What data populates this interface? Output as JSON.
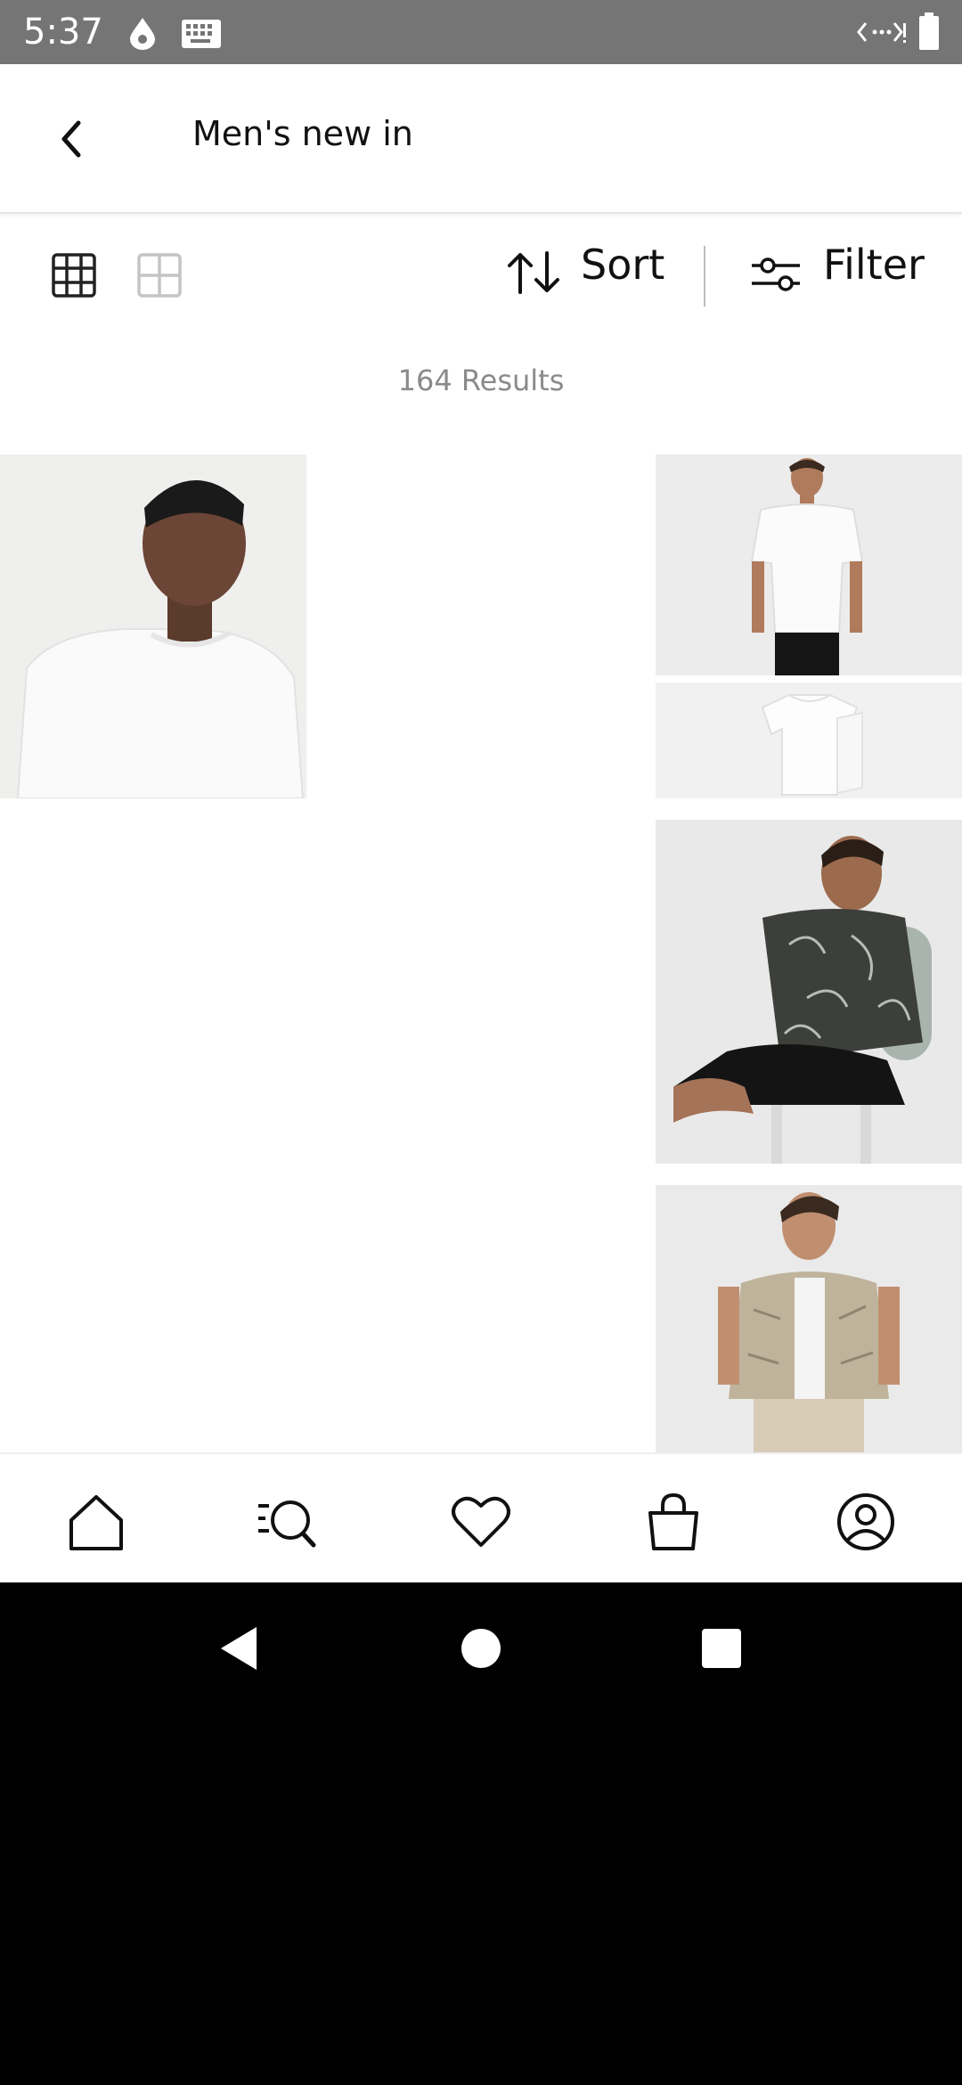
{
  "status_bar": {
    "time": "5:37",
    "icons": [
      "data-saver-icon",
      "keyboard-icon",
      "code-icon",
      "battery-icon"
    ]
  },
  "header": {
    "back_icon": "back-arrow-icon",
    "title": "Men's new in"
  },
  "toolbar": {
    "grid_small_icon": "grid-small-icon",
    "grid_large_icon": "grid-large-icon",
    "sort_icon": "sort-arrows-icon",
    "sort_label": "Sort",
    "filter_icon": "filter-sliders-icon",
    "filter_label": "Filter"
  },
  "results_text": "164 Results",
  "products": [
    {
      "name": "white-tshirt-closeup",
      "image": "man-white-tshirt-photo"
    },
    {
      "name": "white-tshirt-fullbody",
      "image": "man-white-tshirt-black-shorts-photo"
    },
    {
      "name": "white-tshirt-folded",
      "image": "white-tshirt-flatlay-photo"
    },
    {
      "name": "leaf-print-shirt",
      "image": "man-leaf-print-shirt-photo"
    },
    {
      "name": "stone-print-shirt",
      "image": "man-stone-print-shirt-photo"
    }
  ],
  "bottom_nav": [
    "home-icon",
    "search-icon",
    "wishlist-icon",
    "bag-icon",
    "account-icon"
  ],
  "system_nav": [
    "back-icon",
    "home-circle-icon",
    "recents-icon"
  ],
  "colors": {
    "status_bar": "#757575",
    "text": "#111111",
    "muted_text": "#8a8a8a",
    "background": "#ffffff"
  }
}
